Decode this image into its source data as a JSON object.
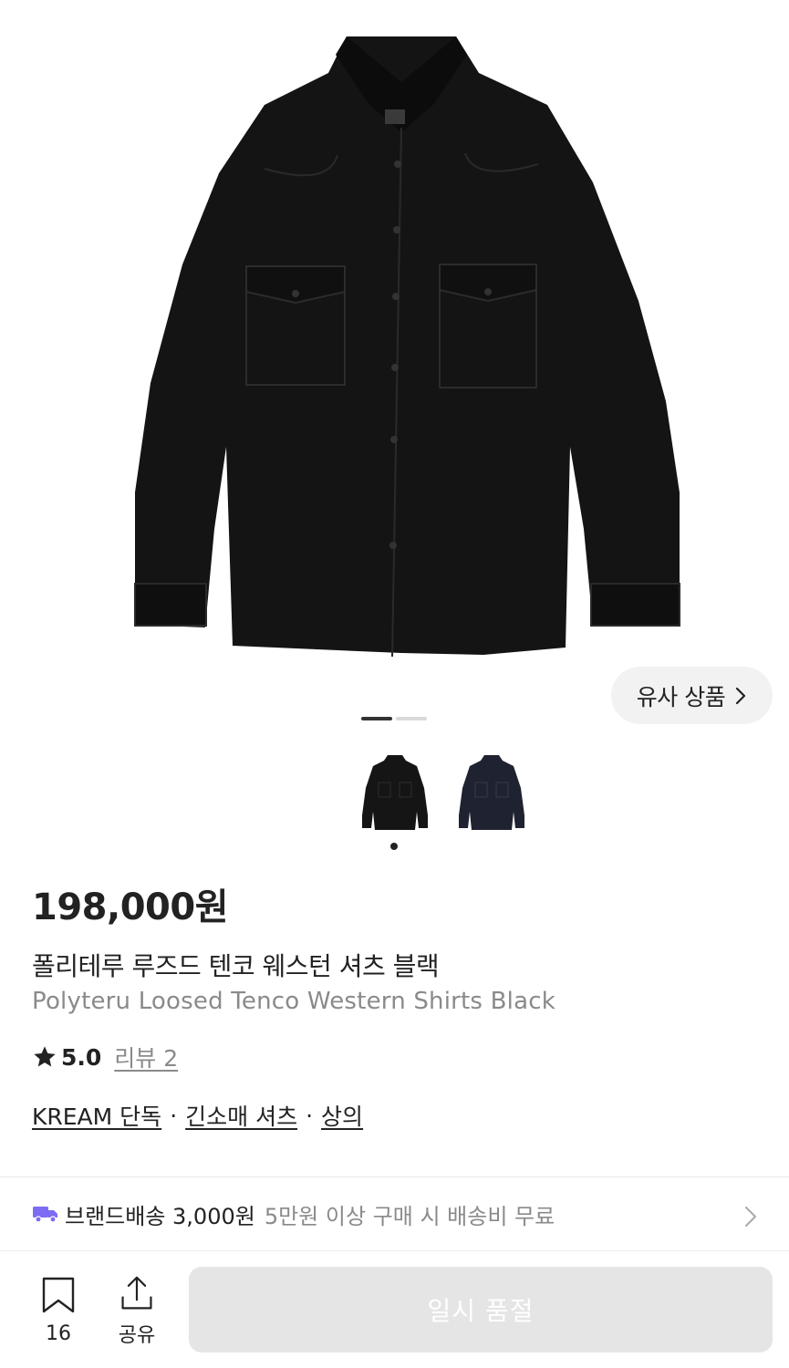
{
  "product": {
    "similar_label": "유사 상품",
    "price": "198,000원",
    "name_ko": "폴리테루 루즈드 텐코 웨스턴 셔츠 블랙",
    "name_en": "Polyteru Loosed Tenco Western Shirts Black",
    "rating": "5.0",
    "review_label": "리뷰 2",
    "tags": [
      "KREAM 단독",
      "긴소매 셔츠",
      "상의"
    ],
    "tag_separator": "·",
    "images": [
      "black-western-shirt",
      "navy-western-shirt"
    ],
    "gallery_page": 1,
    "gallery_total": 2
  },
  "delivery": {
    "icon": "truck-icon",
    "label": "브랜드배송 3,000원",
    "note": "5만원 이상 구매 시 배송비 무료"
  },
  "bottom_bar": {
    "wish_count": "16",
    "share_label": "공유",
    "soldout_label": "일시 품절"
  },
  "colors": {
    "accent_truck": "#7d6cf2",
    "soldout_bg": "#e5e5e5",
    "secondary_text": "#8a8a8a"
  }
}
